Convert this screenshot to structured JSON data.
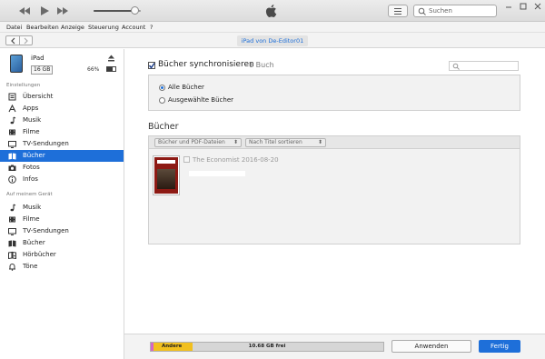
{
  "window": {
    "search_placeholder": "Suchen",
    "volume_level": 0.86
  },
  "menubar": {
    "items": [
      "Datei",
      "Bearbeiten",
      "Anzeige",
      "Steuerung",
      "Account",
      "?"
    ]
  },
  "nav": {
    "device_pill": "iPad von De-Editor01"
  },
  "device": {
    "name": "iPad",
    "capacity": "16 GB",
    "battery_pct": "66%",
    "battery_level": 0.66
  },
  "sidebar": {
    "settings_header": "Einstellungen",
    "settings_items": [
      {
        "label": "Übersicht",
        "icon": "summary-icon"
      },
      {
        "label": "Apps",
        "icon": "apps-icon"
      },
      {
        "label": "Musik",
        "icon": "music-note-icon"
      },
      {
        "label": "Filme",
        "icon": "film-icon"
      },
      {
        "label": "TV-Sendungen",
        "icon": "tv-icon"
      },
      {
        "label": "Bücher",
        "icon": "book-icon"
      },
      {
        "label": "Fotos",
        "icon": "camera-icon"
      },
      {
        "label": "Infos",
        "icon": "info-icon"
      }
    ],
    "selected_index": 5,
    "device_header": "Auf meinem Gerät",
    "device_items": [
      {
        "label": "Musik",
        "icon": "music-note-icon"
      },
      {
        "label": "Filme",
        "icon": "film-icon"
      },
      {
        "label": "TV-Sendungen",
        "icon": "tv-icon"
      },
      {
        "label": "Bücher",
        "icon": "book-icon"
      },
      {
        "label": "Hörbücher",
        "icon": "audiobook-icon"
      },
      {
        "label": "Töne",
        "icon": "bell-icon"
      }
    ]
  },
  "main": {
    "sync_label": "Bücher synchronisieren",
    "sync_count": "1 Buch",
    "sync_checked": true,
    "radio_all": "Alle Bücher",
    "radio_selected": "Ausgewählte Bücher",
    "books_heading": "Bücher",
    "filter_dropdown": "Bücher und PDF-Dateien",
    "sort_dropdown": "Nach Titel sortieren",
    "book_title": "The Economist 2016-08-20"
  },
  "bottom": {
    "other_label": "Andere",
    "free_label": "10.68 GB frei",
    "revert_label": "Anwenden",
    "done_label": "Fertig"
  },
  "colors": {
    "accent": "#1e6fd9",
    "capacity_other": "#f2c01e",
    "capacity_purple": "#d466c6"
  }
}
